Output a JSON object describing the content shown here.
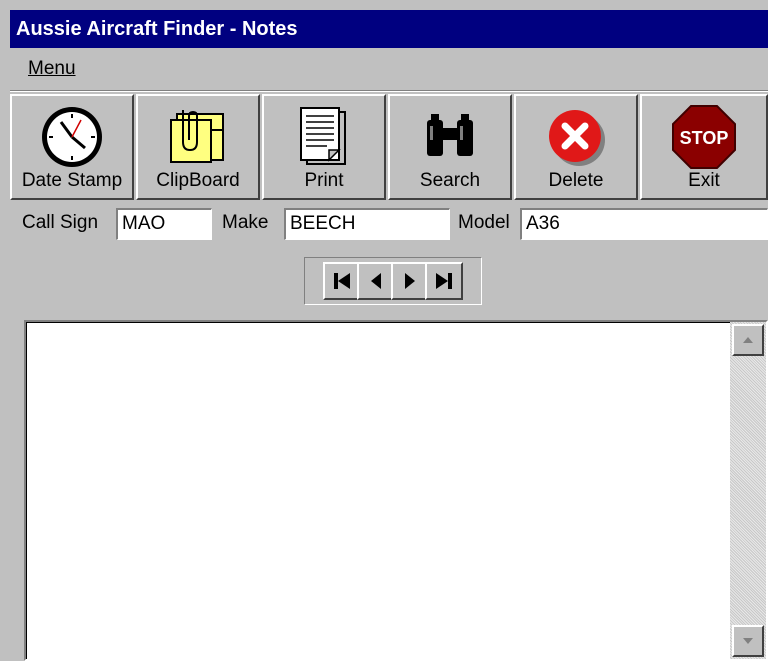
{
  "window": {
    "title": "Aussie Aircraft Finder - Notes"
  },
  "menubar": {
    "menu_label": "Menu"
  },
  "toolbar": {
    "buttons": [
      {
        "label": "Date Stamp",
        "icon": "clock-icon"
      },
      {
        "label": "ClipBoard",
        "icon": "clipboard-icon"
      },
      {
        "label": "Print",
        "icon": "document-icon"
      },
      {
        "label": "Search",
        "icon": "binoculars-icon"
      },
      {
        "label": "Delete",
        "icon": "delete-x-icon"
      },
      {
        "label": "Exit",
        "icon": "stop-sign-icon",
        "icon_text": "STOP"
      }
    ]
  },
  "fields": {
    "call_sign": {
      "label": "Call Sign",
      "value": "MAO"
    },
    "make": {
      "label": "Make",
      "value": "BEECH"
    },
    "model": {
      "label": "Model",
      "value": "A36"
    }
  },
  "navigation": [
    "first-record",
    "previous-record",
    "next-record",
    "last-record"
  ],
  "notes": {
    "value": ""
  },
  "colors": {
    "titlebar": "#000080",
    "face": "#c0c0c0",
    "delete_red": "#e01818",
    "stop_red": "#8b0000",
    "clipboard_yellow": "#ffff80"
  }
}
